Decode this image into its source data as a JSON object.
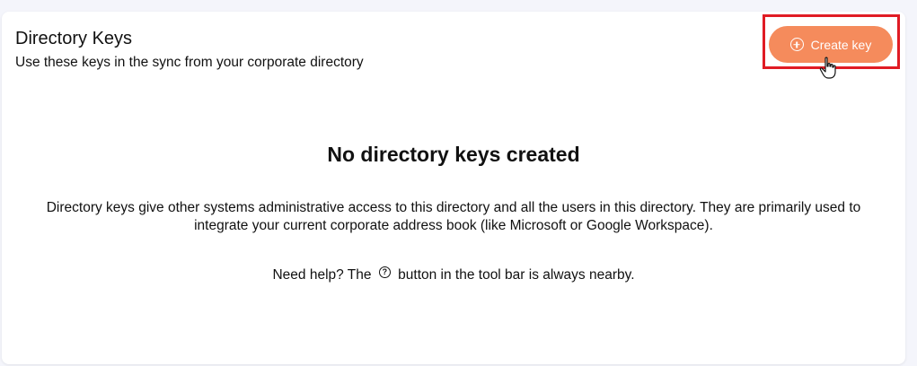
{
  "header": {
    "title": "Directory Keys",
    "subtitle": "Use these keys in the sync from your corporate directory"
  },
  "toolbar": {
    "create_label": "Create key",
    "create_icon": "plus-circle-icon",
    "accent_color": "#f58b5c",
    "highlight_color": "#e01b24"
  },
  "empty_state": {
    "title": "No directory keys created",
    "description_line1": "Directory keys give other systems administrative access to this directory and all the users in this directory. They are primarily used to",
    "description_line2": "integrate your current corporate address book (like Microsoft or Google Workspace).",
    "help_prefix": "Need help? The",
    "help_icon_glyph": "?",
    "help_suffix": "button in the tool bar is always nearby."
  }
}
